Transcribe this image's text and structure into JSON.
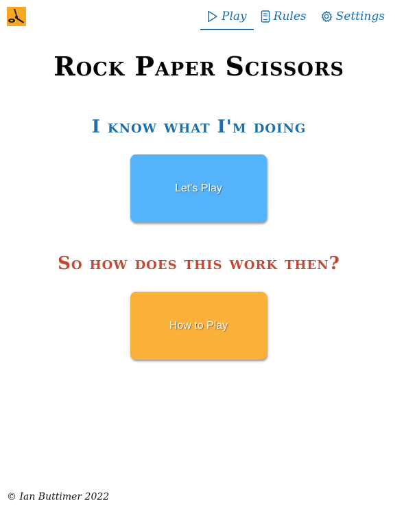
{
  "logo": {
    "icon": "scissors-logo-icon",
    "color": "#f7a823"
  },
  "nav": {
    "items": [
      {
        "label": "Play",
        "icon": "play-icon",
        "active": true
      },
      {
        "label": "Rules",
        "icon": "book-icon",
        "active": false
      },
      {
        "label": "Settings",
        "icon": "gear-icon",
        "active": false
      }
    ],
    "color": "#1e6fb0"
  },
  "title": "Rock Paper Scissors",
  "sections": {
    "play": {
      "heading": "I know what I'm doing",
      "button_label": "Let's Play",
      "heading_color": "#1f6ea6",
      "button_color": "#55b3fb"
    },
    "rules": {
      "heading": "So how does this work then?",
      "button_label": "How to Play",
      "heading_color": "#c24a34",
      "button_color": "#fbb03b"
    }
  },
  "footer": {
    "copyright": "© Ian Buttimer 2022"
  }
}
